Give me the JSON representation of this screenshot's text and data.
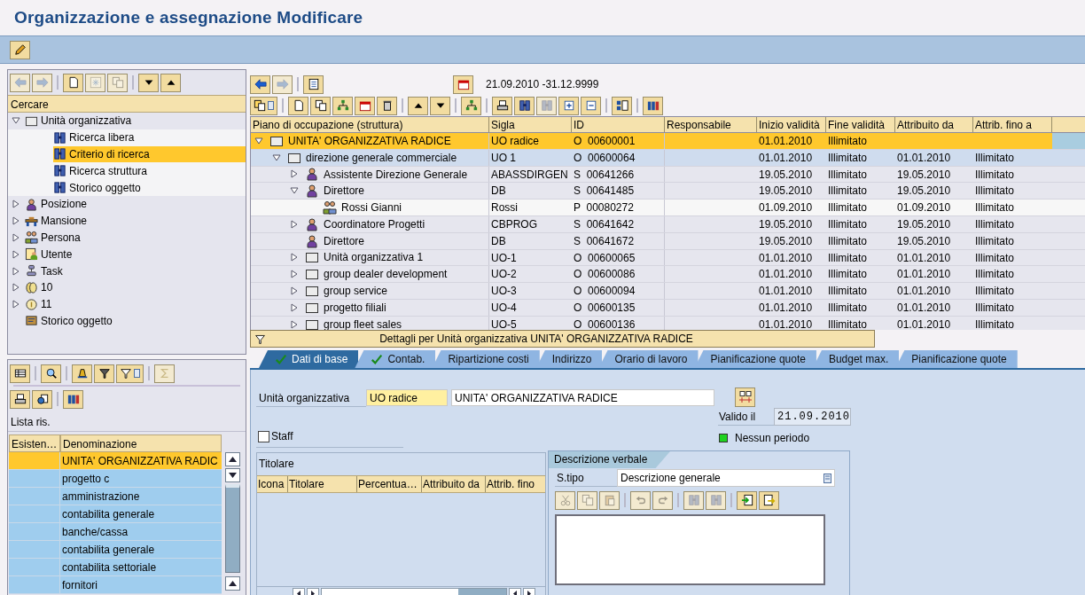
{
  "window": {
    "title": "Organizzazione e assegnazione Modificare"
  },
  "app_toolbar": [
    {
      "kind": "pencil",
      "disabled": false
    }
  ],
  "search_panel": {
    "toolbar": [
      {
        "kind": "arrow-left",
        "disabled": true
      },
      {
        "kind": "arrow-right",
        "disabled": true
      },
      {
        "kind": "sep"
      },
      {
        "kind": "new",
        "disabled": false
      },
      {
        "kind": "star",
        "disabled": true
      },
      {
        "kind": "copy",
        "disabled": true
      },
      {
        "kind": "sep"
      },
      {
        "kind": "triangle-down",
        "disabled": false
      },
      {
        "kind": "triangle-up",
        "disabled": false
      }
    ],
    "header": "Cercare",
    "tree": [
      {
        "label": "Unità organizzativa",
        "kind": "org",
        "expanded": true,
        "selected": false,
        "children": [
          {
            "label": "Ricerca libera",
            "kind": "binoculars",
            "selected": false
          },
          {
            "label": "Criterio di ricerca",
            "kind": "binoculars",
            "selected": true
          },
          {
            "label": "Ricerca struttura",
            "kind": "binoculars",
            "selected": false
          },
          {
            "label": "Storico oggetto",
            "kind": "binoculars",
            "selected": false
          }
        ]
      },
      {
        "label": "Posizione",
        "kind": "position",
        "expanded": false,
        "selected": false
      },
      {
        "label": "Mansione",
        "kind": "job",
        "expanded": false,
        "selected": false
      },
      {
        "label": "Persona",
        "kind": "person",
        "expanded": false,
        "selected": false
      },
      {
        "label": "Utente",
        "kind": "user",
        "expanded": false,
        "selected": false
      },
      {
        "label": "Task",
        "kind": "task",
        "expanded": false,
        "selected": false
      },
      {
        "label": "10",
        "kind": "coins",
        "expanded": false,
        "selected": false
      },
      {
        "label": "11",
        "kind": "coin",
        "expanded": false,
        "selected": false
      },
      {
        "label": "Storico oggetto",
        "kind": "history",
        "selected": false
      }
    ]
  },
  "results_panel": {
    "toolbar": [
      {
        "kind": "table",
        "disabled": false
      },
      {
        "kind": "sep"
      },
      {
        "kind": "magnifier",
        "disabled": false
      },
      {
        "kind": "sep"
      },
      {
        "kind": "sort",
        "disabled": false
      },
      {
        "kind": "filter",
        "disabled": false
      },
      {
        "kind": "filter-menu",
        "disabled": false
      },
      {
        "kind": "sep"
      },
      {
        "kind": "sum",
        "disabled": true
      }
    ],
    "toolbar_2": [
      {
        "kind": "print",
        "disabled": false
      },
      {
        "kind": "export",
        "disabled": false
      },
      {
        "kind": "sep"
      },
      {
        "kind": "columns",
        "disabled": false
      }
    ],
    "title": "Lista ris.",
    "columns": [
      "Esisten…",
      "Denominazione"
    ],
    "rows": [
      {
        "name": "UNITA' ORGANIZZATIVA RADIC",
        "selected": true
      },
      {
        "name": "progetto c",
        "selected": false
      },
      {
        "name": "amministrazione",
        "selected": false
      },
      {
        "name": "contabilita generale",
        "selected": false
      },
      {
        "name": "banche/cassa",
        "selected": false
      },
      {
        "name": "contabilita generale",
        "selected": false
      },
      {
        "name": "contabilita settoriale",
        "selected": false
      },
      {
        "name": "fornitori",
        "selected": false
      }
    ]
  },
  "structure": {
    "toolbar": [
      {
        "kind": "arrow-left",
        "disabled": false
      },
      {
        "kind": "arrow-right",
        "disabled": true
      },
      {
        "kind": "sep"
      },
      {
        "kind": "list",
        "disabled": false
      }
    ],
    "date_range": "21.09.2010 -31.12.9999",
    "toolbar_2": [
      {
        "kind": "copy-menu",
        "disabled": false
      },
      {
        "kind": "sep"
      },
      {
        "kind": "new",
        "disabled": false
      },
      {
        "kind": "copy",
        "disabled": false
      },
      {
        "kind": "hierarchy",
        "disabled": false
      },
      {
        "kind": "calendar",
        "disabled": false
      },
      {
        "kind": "delete",
        "disabled": false
      },
      {
        "kind": "sep"
      },
      {
        "kind": "triangle-up",
        "disabled": false
      },
      {
        "kind": "triangle-down",
        "disabled": false
      },
      {
        "kind": "sep"
      },
      {
        "kind": "hierarchy",
        "disabled": false
      },
      {
        "kind": "sep"
      },
      {
        "kind": "print",
        "disabled": false
      },
      {
        "kind": "binoculars",
        "disabled": false
      },
      {
        "kind": "binoculars",
        "disabled": true
      },
      {
        "kind": "expand",
        "disabled": false
      },
      {
        "kind": "collapse",
        "disabled": false
      },
      {
        "kind": "sep"
      },
      {
        "kind": "layout",
        "disabled": false
      },
      {
        "kind": "sep"
      },
      {
        "kind": "columns",
        "disabled": false
      }
    ],
    "columns": [
      "Piano di occupazione (struttura)",
      "Sigla",
      "ID",
      "Responsabile",
      "Inizio validità",
      "Fine validità",
      "Attribuito da",
      "Attrib. fino a"
    ],
    "rows": [
      {
        "label": "UNITA' ORGANIZZATIVA RADICE",
        "kind": "org",
        "expanded": true,
        "selected": true,
        "sigla": "UO radice",
        "id": "O  00600001",
        "start": "01.01.2010",
        "end": "Illimitato",
        "children": [
          {
            "label": "direzione generale commerciale",
            "kind": "org",
            "expanded": true,
            "selected": false,
            "sigla": "UO 1",
            "id": "O  00600064",
            "start": "01.01.2010",
            "end": "Illimitato",
            "assigned_from": "01.01.2010",
            "assigned_to": "Illimitato",
            "children": [
              {
                "label": "Assistente Direzione Generale",
                "kind": "position",
                "expanded": false,
                "selected": false,
                "sigla": "ABASSDIRGEN",
                "id": "S  00641266",
                "start": "19.05.2010",
                "end": "Illimitato",
                "assigned_from": "19.05.2010",
                "assigned_to": "Illimitato"
              },
              {
                "label": "Direttore",
                "kind": "position",
                "expanded": true,
                "selected": false,
                "sigla": "DB",
                "id": "S  00641485",
                "start": "19.05.2010",
                "end": "Illimitato",
                "assigned_from": "19.05.2010",
                "assigned_to": "Illimitato",
                "children": [
                  {
                    "label": "Rossi Gianni",
                    "kind": "person",
                    "selected": false,
                    "sigla": "Rossi",
                    "id": "P  00080272",
                    "start": "01.09.2010",
                    "end": "Illimitato",
                    "assigned_from": "01.09.2010",
                    "assigned_to": "Illimitato"
                  }
                ]
              },
              {
                "label": "Coordinatore Progetti",
                "kind": "position",
                "expanded": false,
                "selected": false,
                "sigla": "CBPROG",
                "id": "S  00641642",
                "start": "19.05.2010",
                "end": "Illimitato",
                "assigned_from": "19.05.2010",
                "assigned_to": "Illimitato"
              },
              {
                "label": "Direttore",
                "kind": "position",
                "selected": false,
                "sigla": "DB",
                "id": "S  00641672",
                "start": "19.05.2010",
                "end": "Illimitato",
                "assigned_from": "19.05.2010",
                "assigned_to": "Illimitato"
              },
              {
                "label": "Unità organizzativa 1",
                "kind": "org",
                "expanded": false,
                "selected": false,
                "sigla": "UO-1",
                "id": "O  00600065",
                "start": "01.01.2010",
                "end": "Illimitato",
                "assigned_from": "01.01.2010",
                "assigned_to": "Illimitato"
              },
              {
                "label": "group dealer development",
                "kind": "org",
                "expanded": false,
                "selected": false,
                "sigla": "UO-2",
                "id": "O  00600086",
                "start": "01.01.2010",
                "end": "Illimitato",
                "assigned_from": "01.01.2010",
                "assigned_to": "Illimitato"
              },
              {
                "label": "group service",
                "kind": "org",
                "expanded": false,
                "selected": false,
                "sigla": "UO-3",
                "id": "O  00600094",
                "start": "01.01.2010",
                "end": "Illimitato",
                "assigned_from": "01.01.2010",
                "assigned_to": "Illimitato"
              },
              {
                "label": "progetto filiali",
                "kind": "org",
                "expanded": false,
                "selected": false,
                "sigla": "UO-4",
                "id": "O  00600135",
                "start": "01.01.2010",
                "end": "Illimitato",
                "assigned_from": "01.01.2010",
                "assigned_to": "Illimitato"
              },
              {
                "label": "group fleet sales",
                "kind": "org",
                "expanded": false,
                "selected": false,
                "sigla": "UO-5",
                "id": "O  00600136",
                "start": "01.01.2010",
                "end": "Illimitato",
                "assigned_from": "01.01.2010",
                "assigned_to": "Illimitato"
              }
            ]
          }
        ]
      }
    ]
  },
  "detail_bar": "Dettagli per Unità organizzativa UNITA' ORGANIZZATIVA RADICE",
  "tabs": [
    {
      "label": "Dati di base",
      "checked": true,
      "selected": true
    },
    {
      "label": "Contab.",
      "checked": true,
      "selected": false
    },
    {
      "label": "Ripartizione costi",
      "checked": false,
      "selected": false
    },
    {
      "label": "Indirizzo",
      "checked": false,
      "selected": false
    },
    {
      "label": "Orario di lavoro",
      "checked": false,
      "selected": false
    },
    {
      "label": "Pianificazione quote",
      "checked": false,
      "selected": false
    },
    {
      "label": "Budget max.",
      "checked": false,
      "selected": false
    },
    {
      "label": "Pianificazione quote",
      "checked": false,
      "selected": false
    }
  ],
  "form": {
    "unit_label": "Unità organizzativa",
    "unit_short": "UO radice",
    "unit_name": "UNITA' ORGANIZZATIVA RADICE",
    "valid_label": "Valido il",
    "valid_date": "21.09.2010",
    "staff": {
      "label": "Staff",
      "checked": false
    },
    "period_status": {
      "label": "Nessun periodo",
      "ok": true
    }
  },
  "holders": {
    "title": "Titolare",
    "columns": [
      "Icona",
      "Titolare",
      "Percentua…",
      "Attribuito da",
      "Attrib. fino"
    ]
  },
  "description": {
    "tab": "Descrizione verbale",
    "type_label": "S.tipo",
    "type_value": "Descrizione generale",
    "toolbar": [
      {
        "kind": "scissors",
        "disabled": true
      },
      {
        "kind": "copy-doc",
        "disabled": true
      },
      {
        "kind": "paste",
        "disabled": true
      },
      {
        "kind": "sep"
      },
      {
        "kind": "undo",
        "disabled": true
      },
      {
        "kind": "redo",
        "disabled": true
      },
      {
        "kind": "sep"
      },
      {
        "kind": "binoculars",
        "disabled": true
      },
      {
        "kind": "binoculars-plus",
        "disabled": true
      },
      {
        "kind": "sep"
      },
      {
        "kind": "import",
        "disabled": false
      },
      {
        "kind": "export-doc",
        "disabled": false
      }
    ]
  }
}
